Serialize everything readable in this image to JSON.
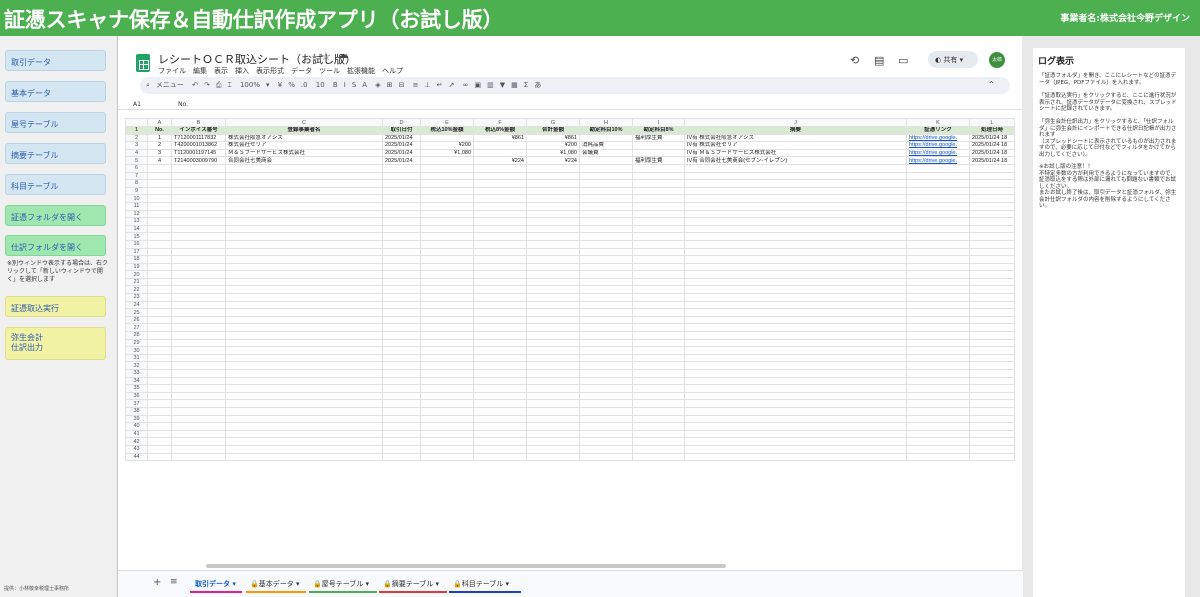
{
  "header": {
    "title": "証憑スキャナ保存＆自動仕訳作成アプリ（お試し版）",
    "business": "事業者名:株式会社今野デザイン"
  },
  "sidebar": {
    "buttons": [
      {
        "label": "取引データ",
        "color": "blue"
      },
      {
        "label": "基本データ",
        "color": "blue"
      },
      {
        "label": "屋号テーブル",
        "color": "blue"
      },
      {
        "label": "摘要テーブル",
        "color": "blue"
      },
      {
        "label": "科目テーブル",
        "color": "blue"
      },
      {
        "label": "証憑フォルダを開く",
        "color": "green"
      },
      {
        "label": "仕訳フォルダを開く",
        "color": "green"
      },
      {
        "label": "証憑取込実行",
        "color": "yellow"
      },
      {
        "label": "弥生会計\n仕訳出力",
        "color": "yellow"
      }
    ],
    "note": "※別ウィンドウ表示する場合は、右クリックして「新しいウィンドウで開く」を選択します",
    "footer": "提供：小林敬幸税理士事務所"
  },
  "sheet": {
    "title": "レシートＯＣＲ取込シート（お試し版）",
    "menu": [
      "ファイル",
      "編集",
      "表示",
      "挿入",
      "表示形式",
      "データ",
      "ツール",
      "拡張機能",
      "ヘルプ"
    ],
    "share": "共有",
    "avatar": "太郎",
    "toolbar": {
      "search": "メニュー",
      "zoom": "100%",
      "font_size": "10"
    },
    "cell_ref": "A1",
    "formula": "No.",
    "columns": [
      "A",
      "B",
      "C",
      "D",
      "E",
      "F",
      "G",
      "H",
      "I",
      "J",
      "K",
      "L"
    ],
    "headers": [
      "No.",
      "インボイス番号",
      "登録事業者名",
      "取引日付",
      "税込10%金額",
      "税込8%金額",
      "合計金額",
      "勘定科目10%",
      "勘定科目8%",
      "摘要",
      "証憑リンク",
      "処理日時"
    ],
    "rows": [
      [
        "1",
        "T7120001117832",
        "株式会社阪急オアシス",
        "2025/01/24",
        "",
        "¥861",
        "¥861",
        "",
        "福利厚生費",
        "IV有 株式会社阪急オアシス",
        "https://drive.google.",
        "2025/01/24 18"
      ],
      [
        "2",
        "T4200001013862",
        "株式会社セリア",
        "2025/01/24",
        "¥200",
        "",
        "¥200",
        "消耗品費",
        "",
        "IV有 株式会社セリア",
        "https://drive.google.",
        "2025/01/24 18"
      ],
      [
        "3",
        "T1120001197145",
        "Ｍ＆Ｓフードサービス株式会社",
        "2025/01/24",
        "¥1,080",
        "",
        "¥1,080",
        "会議費",
        "",
        "IV有 Ｍ＆Ｓフードサービス株式会社",
        "https://drive.google.",
        "2025/01/24 18"
      ],
      [
        "4",
        "T2140003009790",
        "合同会社七美商会",
        "2025/01/24",
        "",
        "¥224",
        "¥224",
        "",
        "福利厚生費",
        "IV有 合同会社七美商会(セブン-イレブン)",
        "https://drive.google.",
        "2025/01/24 18"
      ]
    ],
    "tabs": [
      {
        "label": "取引データ",
        "color": "#e91e8c"
      },
      {
        "label": "基本データ",
        "color": "#ff9800"
      },
      {
        "label": "屋号テーブル",
        "color": "#4caf50"
      },
      {
        "label": "摘要テーブル",
        "color": "#e53935"
      },
      {
        "label": "科目テーブル",
        "color": "#1e40c8"
      }
    ]
  },
  "log": {
    "title": "ログ表示",
    "paragraphs": [
      "「証憑フォルダ」を開き、ここにレシートなどの証憑データ（JPEG、PDFファイル）を入れます。",
      "「証憑取込実行」をクリックすると、ここに進行状況が表示され、証憑データがデータに変換され、スプレッドシートに記録されていきます。",
      "「弥生会計仕訳出力」をクリックすると、「仕訳フォルダ」に弥生会計にインポートできる仕訳日記帳が出力されます\n（スプレッドシートに表示されているものが出力されますので、必要に応じて日付などでフィルタをかけてから出力してください）。",
      "※お試し版の注意！！\n不特定多数の方が利用できるようになっていますので、証憑取込をする際は外部に漏れても問題ない書類でお試しください。\nまたお試し終了後は、取引データと証憑フォルダ、弥生会計仕訳フォルダの内容を削除するようにしてください。"
    ]
  }
}
